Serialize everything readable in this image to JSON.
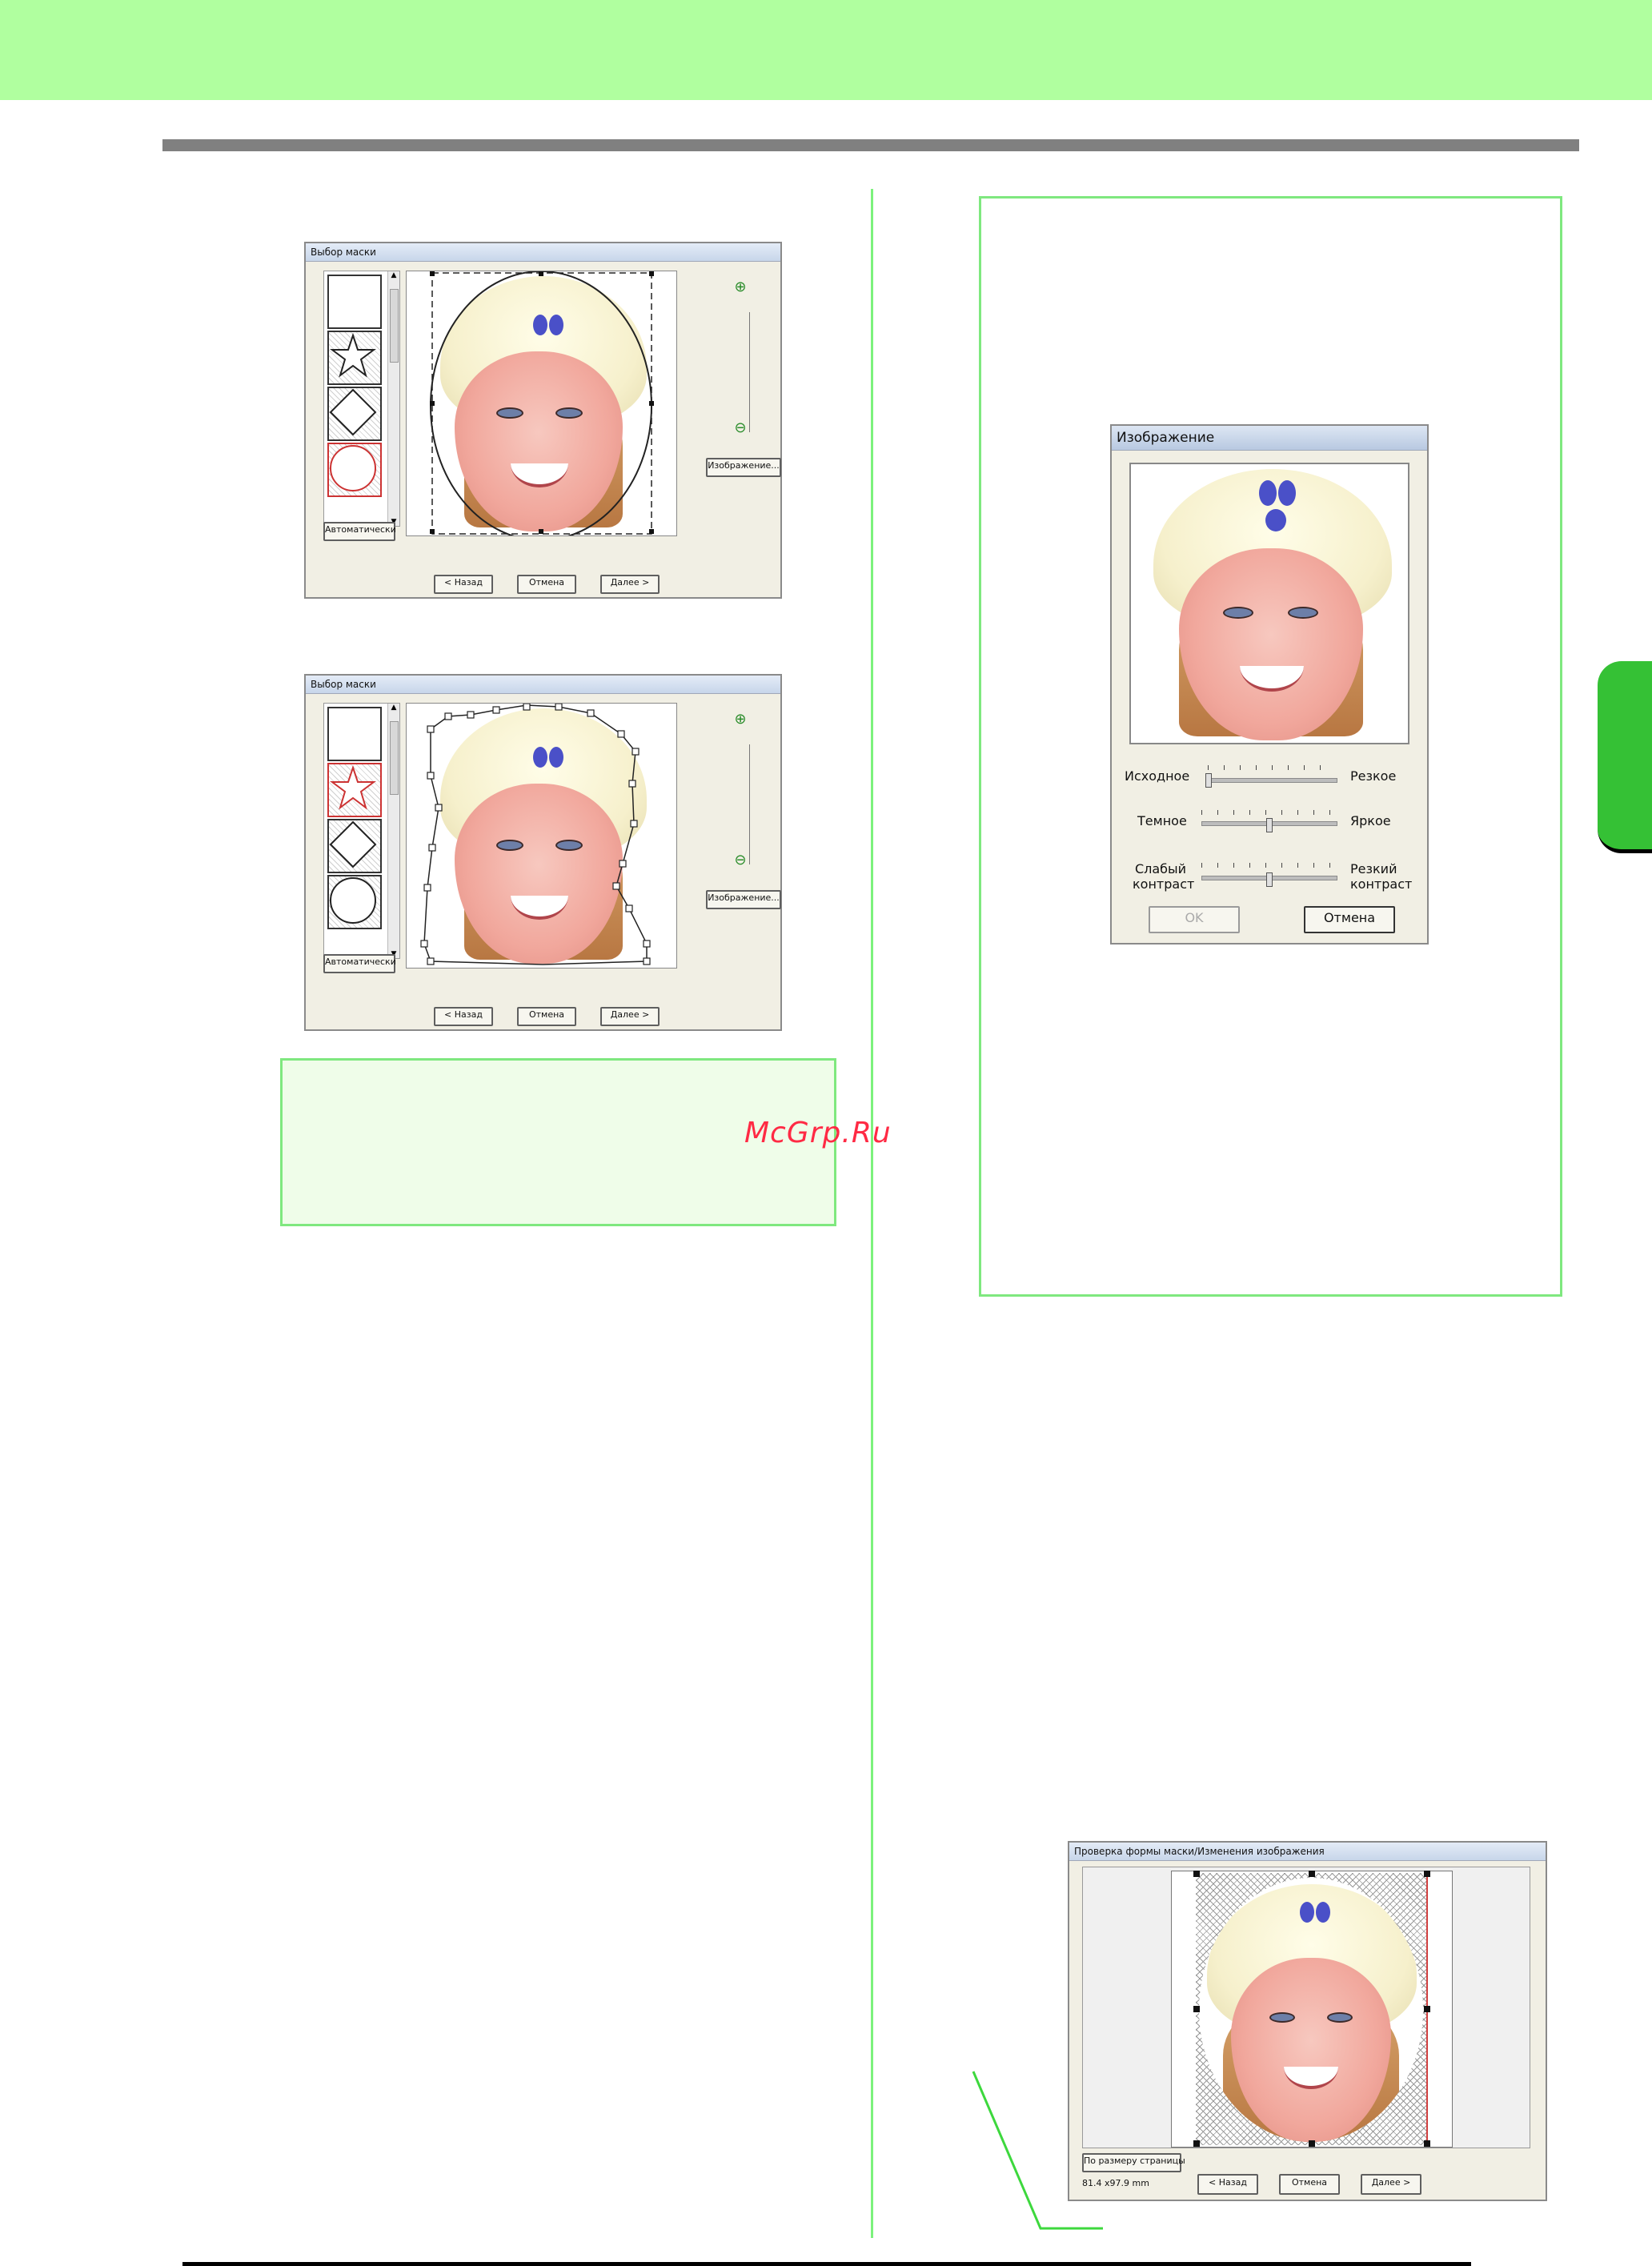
{
  "page": {
    "watermark": "McGrp.Ru"
  },
  "mask_dialog_1": {
    "title": "Выбор маски",
    "auto_label": "Автоматически",
    "image_label": "Изображение...",
    "back_label": "< Назад",
    "cancel_label": "Отмена",
    "next_label": "Далее >"
  },
  "mask_dialog_2": {
    "title": "Выбор маски",
    "auto_label": "Автоматически",
    "image_label": "Изображение...",
    "back_label": "< Назад",
    "cancel_label": "Отмена",
    "next_label": "Далее >"
  },
  "image_dialog": {
    "title": "Изображение",
    "sliders": [
      {
        "left": "Исходное",
        "right": "Резкое",
        "level": 0.0
      },
      {
        "left": "Темное",
        "right": "Яркое",
        "level": 0.5
      },
      {
        "left": "Слабый контраст",
        "right": "Резкий контраст",
        "level": 0.5
      }
    ],
    "ok_label": "OK",
    "cancel_label": "Отмена"
  },
  "check_dialog": {
    "title": "Проверка формы маски/Изменения изображения",
    "fit_page_label": "По размеру страницы",
    "size_readout": "81.4 x97.9 mm",
    "back_label": "< Назад",
    "cancel_label": "Отмена",
    "next_label": "Далее >"
  },
  "colors": {
    "band_green": "#b0ff9f",
    "rule_gray": "#808080",
    "note_border": "#7fe87f",
    "tab_green": "#35c135"
  }
}
